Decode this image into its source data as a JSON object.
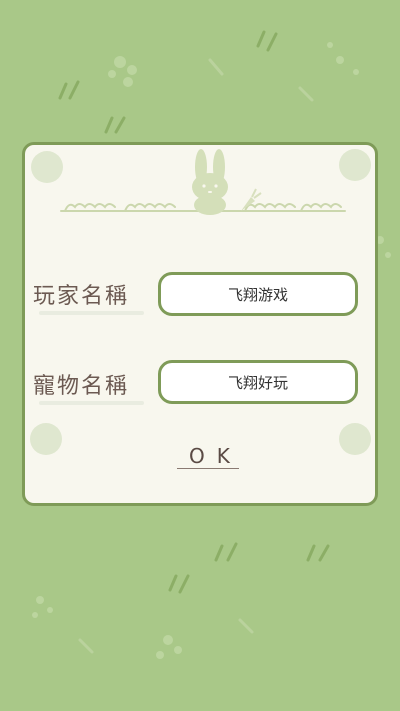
{
  "form": {
    "player_name_label": "玩家名稱",
    "player_name_value": "飞翔游戏",
    "pet_name_label": "寵物名稱",
    "pet_name_value": "飞翔好玩",
    "ok_label": "OK"
  },
  "colors": {
    "background": "#a9c888",
    "border": "#7f9b58",
    "label_text": "#6c5a52"
  },
  "icons": [
    "rabbit-icon",
    "carrot-icon",
    "grass-icon",
    "leaf-icon"
  ]
}
